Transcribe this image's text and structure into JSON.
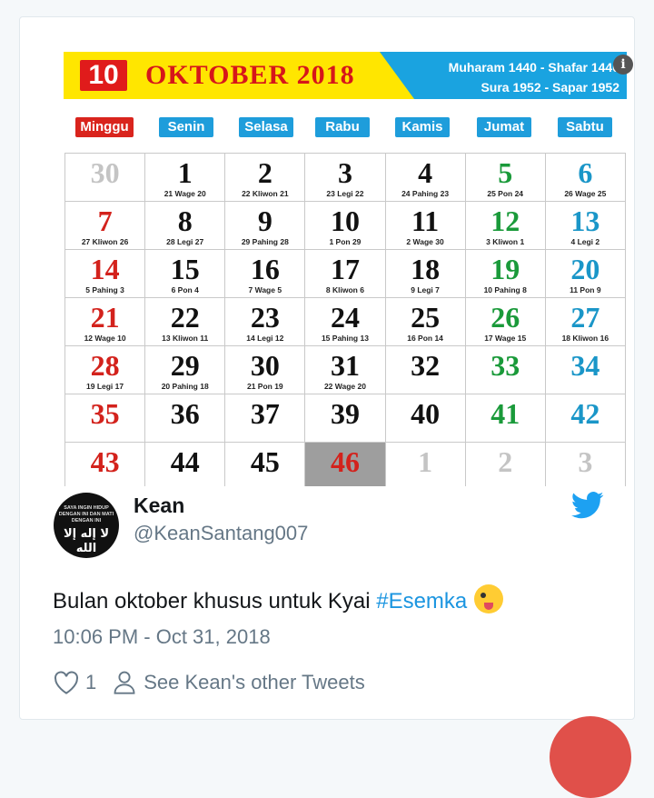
{
  "calendar": {
    "day_number": "10",
    "month_title": "OKTOBER 2018",
    "hijri_line": "Muharam 1440 - Shafar 1440",
    "javanese_line": "Sura 1952 - Sapar 1952",
    "day_headers": [
      {
        "label": "Minggu",
        "color": "#d9241d"
      },
      {
        "label": "Senin",
        "color": "#1e9ddb"
      },
      {
        "label": "Selasa",
        "color": "#1e9ddb"
      },
      {
        "label": "Rabu",
        "color": "#1e9ddb"
      },
      {
        "label": "Kamis",
        "color": "#1e9ddb"
      },
      {
        "label": "Jumat",
        "color": "#1e9ddb"
      },
      {
        "label": "Sabtu",
        "color": "#1e9ddb"
      }
    ],
    "weeks": [
      [
        {
          "n": "30",
          "s": "",
          "c": "#c4c4c4"
        },
        {
          "n": "1",
          "s": "21 Wage 20",
          "c": "#111111"
        },
        {
          "n": "2",
          "s": "22 Kliwon 21",
          "c": "#111111"
        },
        {
          "n": "3",
          "s": "23 Legi 22",
          "c": "#111111"
        },
        {
          "n": "4",
          "s": "24 Pahing 23",
          "c": "#111111"
        },
        {
          "n": "5",
          "s": "25 Pon 24",
          "c": "#1a9a3a"
        },
        {
          "n": "6",
          "s": "26 Wage 25",
          "c": "#1a96c8"
        }
      ],
      [
        {
          "n": "7",
          "s": "27 Kliwon 26",
          "c": "#d3221c"
        },
        {
          "n": "8",
          "s": "28 Legi 27",
          "c": "#111111"
        },
        {
          "n": "9",
          "s": "29 Pahing 28",
          "c": "#111111"
        },
        {
          "n": "10",
          "s": "1 Pon 29",
          "c": "#111111"
        },
        {
          "n": "11",
          "s": "2 Wage 30",
          "c": "#111111"
        },
        {
          "n": "12",
          "s": "3 Kliwon 1",
          "c": "#1a9a3a"
        },
        {
          "n": "13",
          "s": "4 Legi 2",
          "c": "#1a96c8"
        }
      ],
      [
        {
          "n": "14",
          "s": "5 Pahing 3",
          "c": "#d3221c"
        },
        {
          "n": "15",
          "s": "6 Pon 4",
          "c": "#111111"
        },
        {
          "n": "16",
          "s": "7 Wage 5",
          "c": "#111111"
        },
        {
          "n": "17",
          "s": "8 Kliwon 6",
          "c": "#111111"
        },
        {
          "n": "18",
          "s": "9 Legi 7",
          "c": "#111111"
        },
        {
          "n": "19",
          "s": "10 Pahing 8",
          "c": "#1a9a3a"
        },
        {
          "n": "20",
          "s": "11 Pon 9",
          "c": "#1a96c8"
        }
      ],
      [
        {
          "n": "21",
          "s": "12 Wage 10",
          "c": "#d3221c"
        },
        {
          "n": "22",
          "s": "13 Kliwon 11",
          "c": "#111111"
        },
        {
          "n": "23",
          "s": "14 Legi 12",
          "c": "#111111"
        },
        {
          "n": "24",
          "s": "15 Pahing 13",
          "c": "#111111"
        },
        {
          "n": "25",
          "s": "16 Pon 14",
          "c": "#111111"
        },
        {
          "n": "26",
          "s": "17 Wage 15",
          "c": "#1a9a3a"
        },
        {
          "n": "27",
          "s": "18 Kliwon 16",
          "c": "#1a96c8"
        }
      ],
      [
        {
          "n": "28",
          "s": "19 Legi 17",
          "c": "#d3221c"
        },
        {
          "n": "29",
          "s": "20 Pahing 18",
          "c": "#111111"
        },
        {
          "n": "30",
          "s": "21 Pon 19",
          "c": "#111111"
        },
        {
          "n": "31",
          "s": "22 Wage 20",
          "c": "#111111"
        },
        {
          "n": "32",
          "s": "",
          "c": "#111111"
        },
        {
          "n": "33",
          "s": "",
          "c": "#1a9a3a"
        },
        {
          "n": "34",
          "s": "",
          "c": "#1a96c8"
        }
      ],
      [
        {
          "n": "35",
          "s": "",
          "c": "#d3221c"
        },
        {
          "n": "36",
          "s": "",
          "c": "#111111"
        },
        {
          "n": "37",
          "s": "",
          "c": "#111111"
        },
        {
          "n": "39",
          "s": "",
          "c": "#111111"
        },
        {
          "n": "40",
          "s": "",
          "c": "#111111"
        },
        {
          "n": "41",
          "s": "",
          "c": "#1a9a3a"
        },
        {
          "n": "42",
          "s": "",
          "c": "#1a96c8"
        }
      ],
      [
        {
          "n": "43",
          "s": "",
          "c": "#d3221c"
        },
        {
          "n": "44",
          "s": "",
          "c": "#111111"
        },
        {
          "n": "45",
          "s": "",
          "c": "#111111"
        },
        {
          "n": "46",
          "s": "",
          "c": "#d3221c",
          "bg": "#9e9e9e"
        },
        {
          "n": "1",
          "s": "",
          "c": "#c4c4c4"
        },
        {
          "n": "2",
          "s": "",
          "c": "#c4c4c4"
        },
        {
          "n": "3",
          "s": "",
          "c": "#c4c4c4"
        }
      ]
    ]
  },
  "tweet": {
    "name": "Kean",
    "handle": "@KeanSantang007",
    "text_before": "Bulan oktober khusus untuk Kyai ",
    "hashtag": "#Esemka",
    "emoji": "winking-face-with-tongue",
    "timestamp": "10:06 PM - Oct 31, 2018",
    "like_count": "1",
    "other_tweets_label": "See Kean's other Tweets",
    "avatar_text_top": "SAYA INGIN HIDUP DENGAN INI DAN MATI DENGAN INI",
    "avatar_text_script": "لا إله إلا الله"
  },
  "colors": {
    "link": "#1b95e0",
    "twitter_blue": "#1da1f2",
    "muted": "#657786"
  }
}
